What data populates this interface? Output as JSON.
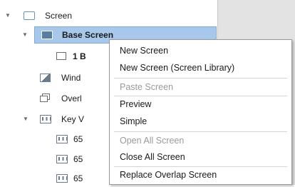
{
  "tree": {
    "items": [
      {
        "label": "Screen",
        "caret": "▼"
      },
      {
        "label": "Base Screen",
        "caret": "▼"
      },
      {
        "label": "1 B"
      },
      {
        "label": "Wind"
      },
      {
        "label": "Overl"
      },
      {
        "label": "Key V",
        "caret": "▼"
      },
      {
        "label": "65"
      },
      {
        "label": "65"
      },
      {
        "label": "65"
      }
    ]
  },
  "context_menu": {
    "items": [
      {
        "label": "New Screen",
        "enabled": true
      },
      {
        "label": "New Screen (Screen Library)",
        "enabled": true
      },
      {
        "label": "Paste Screen",
        "enabled": false
      },
      {
        "label": "Preview",
        "enabled": true
      },
      {
        "label": "Simple",
        "enabled": true
      },
      {
        "label": "Open All Screen",
        "enabled": false
      },
      {
        "label": "Close All Screen",
        "enabled": true
      },
      {
        "label": "Replace Overlap Screen",
        "enabled": true
      }
    ]
  },
  "colors": {
    "selection_background": "#a7c7eb",
    "disabled_text": "#9a9a9a",
    "pane_background": "#e3e3e3"
  }
}
